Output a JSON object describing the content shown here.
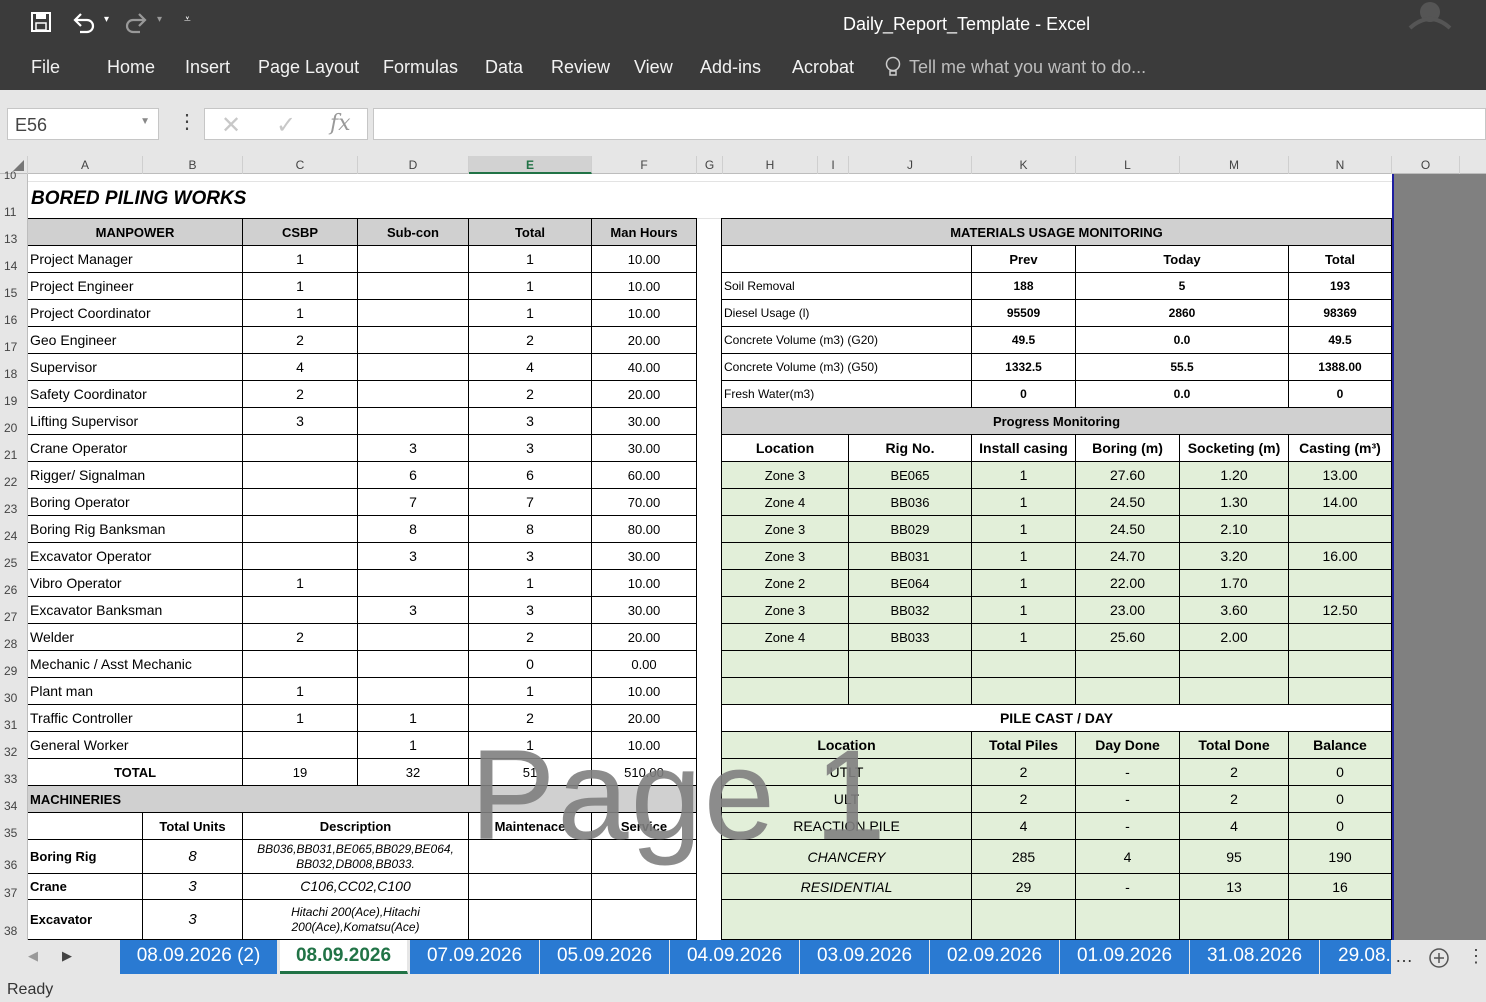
{
  "window": {
    "title": "Daily_Report_Template - Excel"
  },
  "ribbon": {
    "tabs": [
      "File",
      "Home",
      "Insert",
      "Page Layout",
      "Formulas",
      "Data",
      "Review",
      "View",
      "Add-ins",
      "Acrobat"
    ],
    "tell_me": "Tell me what you want to do..."
  },
  "formula_bar": {
    "name_box": "E56",
    "fx": "fx",
    "value": ""
  },
  "columns": [
    "A",
    "B",
    "C",
    "D",
    "E",
    "F",
    "G",
    "H",
    "I",
    "J",
    "K",
    "L",
    "M",
    "N",
    "O"
  ],
  "rows": [
    "10",
    "11",
    "13",
    "14",
    "15",
    "16",
    "17",
    "18",
    "19",
    "20",
    "21",
    "22",
    "23",
    "24",
    "25",
    "26",
    "27",
    "28",
    "29",
    "30",
    "31",
    "32",
    "33",
    "34",
    "35",
    "36",
    "37",
    "38"
  ],
  "title": "BORED PILING WORKS",
  "manpower": {
    "headers": [
      "MANPOWER",
      "CSBP",
      "Sub-con",
      "Total",
      "Man Hours"
    ],
    "rows": [
      [
        "Project Manager",
        "1",
        "",
        "1",
        "10.00"
      ],
      [
        "Project Engineer",
        "1",
        "",
        "1",
        "10.00"
      ],
      [
        "Project Coordinator",
        "1",
        "",
        "1",
        "10.00"
      ],
      [
        "Geo Engineer",
        "2",
        "",
        "2",
        "20.00"
      ],
      [
        "Supervisor",
        "4",
        "",
        "4",
        "40.00"
      ],
      [
        "Safety Coordinator",
        "2",
        "",
        "2",
        "20.00"
      ],
      [
        "Lifting Supervisor",
        "3",
        "",
        "3",
        "30.00"
      ],
      [
        "Crane Operator",
        "",
        "3",
        "3",
        "30.00"
      ],
      [
        "Rigger/ Signalman",
        "",
        "6",
        "6",
        "60.00"
      ],
      [
        "Boring Operator",
        "",
        "7",
        "7",
        "70.00"
      ],
      [
        "Boring Rig Banksman",
        "",
        "8",
        "8",
        "80.00"
      ],
      [
        "Excavator Operator",
        "",
        "3",
        "3",
        "30.00"
      ],
      [
        "Vibro Operator",
        "1",
        "",
        "1",
        "10.00"
      ],
      [
        "Excavator Banksman",
        "",
        "3",
        "3",
        "30.00"
      ],
      [
        "Welder",
        "2",
        "",
        "2",
        "20.00"
      ],
      [
        "Mechanic / Asst Mechanic",
        "",
        "",
        "0",
        "0.00"
      ],
      [
        "Plant man",
        "1",
        "",
        "1",
        "10.00"
      ],
      [
        "Traffic Controller",
        "1",
        "1",
        "2",
        "20.00"
      ],
      [
        "General Worker",
        "",
        "1",
        "1",
        "10.00"
      ]
    ],
    "total": [
      "TOTAL",
      "19",
      "32",
      "51",
      "510.00"
    ]
  },
  "machineries": {
    "title": "MACHINERIES",
    "headers": [
      "Total Units",
      "Description",
      "Maintenace",
      "Service"
    ],
    "rows": [
      [
        "Boring Rig",
        "8",
        "BB036,BB031,BE065,BB029,BE064, BB032,DB008,BB033."
      ],
      [
        "Crane",
        "3",
        "C106,CC02,C100"
      ],
      [
        "Excavator",
        "3",
        "Hitachi 200(Ace),Hitachi 200(Ace),Komatsu(Ace)"
      ]
    ]
  },
  "materials": {
    "title": "MATERIALS USAGE MONITORING",
    "headers": [
      "Prev",
      "Today",
      "Total"
    ],
    "rows": [
      [
        "Soil Removal",
        "188",
        "5",
        "193"
      ],
      [
        "Diesel Usage (l)",
        "95509",
        "2860",
        "98369"
      ],
      [
        "Concrete Volume (m3) (G20)",
        "49.5",
        "0.0",
        "49.5"
      ],
      [
        "Concrete Volume (m3) (G50)",
        "1332.5",
        "55.5",
        "1388.00"
      ],
      [
        "Fresh Water(m3)",
        "0",
        "0.0",
        "0"
      ]
    ]
  },
  "progress": {
    "title": "Progress Monitoring",
    "headers": [
      "Location",
      "Rig No.",
      "Install casing",
      "Boring (m)",
      "Socketing (m)",
      "Casting (m³)"
    ],
    "rows": [
      [
        "Zone 3",
        "BE065",
        "1",
        "27.60",
        "1.20",
        "13.00"
      ],
      [
        "Zone 4",
        "BB036",
        "1",
        "24.50",
        "1.30",
        "14.00"
      ],
      [
        "Zone 3",
        "BB029",
        "1",
        "24.50",
        "2.10",
        ""
      ],
      [
        "Zone 3",
        "BB031",
        "1",
        "24.70",
        "3.20",
        "16.00"
      ],
      [
        "Zone 2",
        "BE064",
        "1",
        "22.00",
        "1.70",
        ""
      ],
      [
        "Zone 3",
        "BB032",
        "1",
        "23.00",
        "3.60",
        "12.50"
      ],
      [
        "Zone 4",
        "BB033",
        "1",
        "25.60",
        "2.00",
        ""
      ]
    ]
  },
  "pilecast": {
    "title": "PILE CAST / DAY",
    "headers": [
      "Location",
      "Total Piles",
      "Day Done",
      "Total Done",
      "Balance"
    ],
    "rows": [
      [
        "UTLT",
        "2",
        "-",
        "2",
        "0"
      ],
      [
        "ULT",
        "2",
        "-",
        "2",
        "0"
      ],
      [
        "REACTION PILE",
        "4",
        "-",
        "4",
        "0"
      ],
      [
        "CHANCERY",
        "285",
        "4",
        "95",
        "190"
      ],
      [
        "RESIDENTIAL",
        "29",
        "-",
        "13",
        "16"
      ]
    ]
  },
  "watermark": "Page 1",
  "sheet_tabs": [
    "08.09.2026 (2)",
    "08.09.2026",
    "07.09.2026",
    "05.09.2026",
    "04.09.2026",
    "03.09.2026",
    "02.09.2026",
    "01.09.2026",
    "31.08.2026",
    "29.08."
  ],
  "status": "Ready"
}
